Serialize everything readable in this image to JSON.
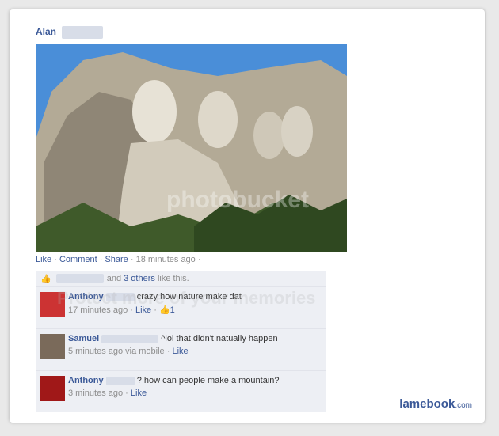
{
  "post": {
    "author": "Alan",
    "actions": {
      "like": "Like",
      "comment": "Comment",
      "share": "Share",
      "time": "18 minutes ago"
    }
  },
  "likes": {
    "connector": "and",
    "others": "3 others",
    "suffix": "like this."
  },
  "comments": [
    {
      "name": "Anthony",
      "text": "crazy how nature make dat",
      "time": "17 minutes ago",
      "like": "Like",
      "like_count": "1"
    },
    {
      "name": "Samuel",
      "text": "^lol that didn't natually happen",
      "time": "5 minutes ago via mobile",
      "like": "Like"
    },
    {
      "name": "Anthony",
      "text": "? how can people make a mountain?",
      "time": "3 minutes ago",
      "like": "Like"
    }
  ],
  "watermark": {
    "text": "photobucket",
    "overlay": "Protect more of your memories"
  },
  "brand": {
    "name": "lamebook",
    "domain": ".com"
  },
  "colors": {
    "link": "#3b5998",
    "sky": "#4c8fd6",
    "rock": "#b9b19f"
  }
}
